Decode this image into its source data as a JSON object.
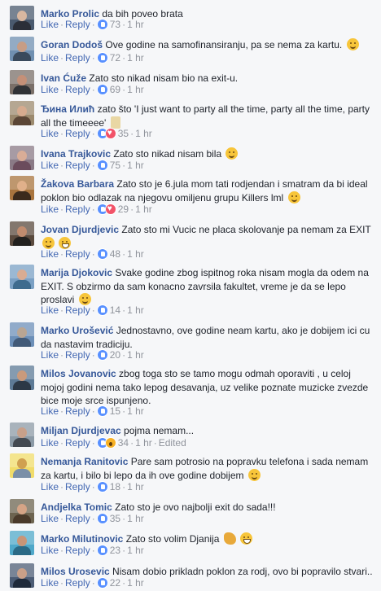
{
  "ui": {
    "like": "Like",
    "reply": "Reply",
    "hours": "1 hr",
    "edited": "Edited",
    "dot": "·"
  },
  "comments": [
    {
      "author": "Marko Prolic",
      "text": "da bih poveo brata",
      "reactions": [
        "like"
      ],
      "count": "73",
      "emoji": [],
      "edited": false,
      "avatar": [
        "#4a5a6e",
        "#d8b7a0",
        "#2b2f38"
      ]
    },
    {
      "author": "Goran Dodoš",
      "text": "Ove godine na samofinansiranju, pa se nema za kartu.",
      "reactions": [
        "like"
      ],
      "count": "72",
      "emoji": [
        "smile"
      ],
      "edited": false,
      "avatar": [
        "#6f8fb0",
        "#c79d85",
        "#3a4a5c"
      ]
    },
    {
      "author": "Ivan Ćuže",
      "text": "Zato sto nikad nisam bio na exit-u.",
      "reactions": [
        "like"
      ],
      "count": "69",
      "emoji": [],
      "edited": false,
      "avatar": [
        "#7a6f68",
        "#c49078",
        "#303236"
      ]
    },
    {
      "author": "Ђина Илић",
      "text": "zato što 'I just want to party all the time, party all the time, party all the timeeee'",
      "reactions": [
        "like",
        "love"
      ],
      "count": "35",
      "emoji": [
        "beer"
      ],
      "edited": false,
      "avatar": [
        "#9c8a6e",
        "#d6ab8f",
        "#5b4636"
      ]
    },
    {
      "author": "Ivana Trajkovic",
      "text": "Zato sto nikad nisam bila",
      "reactions": [
        "like"
      ],
      "count": "75",
      "emoji": [
        "smile"
      ],
      "edited": false,
      "avatar": [
        "#8a7a86",
        "#d9ad97",
        "#6b4c5c"
      ]
    },
    {
      "author": "Žakova Barbara",
      "text": "Zato sto je 6.jula mom tati rodjendan i smatram da bi ideal poklon bio odlazak na njegovu omiljenu grupu Killers lml",
      "reactions": [
        "like",
        "love"
      ],
      "count": "29",
      "emoji": [
        "smile"
      ],
      "edited": false,
      "avatar": [
        "#a8743e",
        "#e0b08a",
        "#3b2a1c"
      ]
    },
    {
      "author": "Jovan Djurdjevic",
      "text": "Zato sto mi Vucic ne placa skolovanje pa nemam za EXIT",
      "reactions": [
        "like"
      ],
      "count": "48",
      "emoji": [
        "smile",
        "laugh"
      ],
      "edited": false,
      "avatar": [
        "#5a4a3e",
        "#c08b6e",
        "#22201e"
      ]
    },
    {
      "author": "Marija Djokovic",
      "text": "Svake godine zbog ispitnog roka nisam mogla da odem na EXIT. S obzirmo da sam konacno zavrsila fakultet, vreme je da se lepo proslavi",
      "reactions": [
        "like"
      ],
      "count": "14",
      "emoji": [
        "smile"
      ],
      "edited": false,
      "avatar": [
        "#7aa0c4",
        "#d9ac93",
        "#3e6b8e"
      ]
    },
    {
      "author": "Marko Urošević",
      "text": "Jednostavno, ove godine neam kartu, ako je dobijem ici cu da nastavim tradiciju.",
      "reactions": [
        "like"
      ],
      "count": "20",
      "emoji": [],
      "edited": false,
      "avatar": [
        "#6c8fb8",
        "#b9a593",
        "#425a78"
      ]
    },
    {
      "author": "Milos Jovanovic",
      "text": "zbog toga sto se tamo mogu odmah oporaviti , u celoj mojoj godini nema tako lepog desavanja, uz velike poznate muzicke zvezde bice moje srce ispunjeno.",
      "reactions": [
        "like"
      ],
      "count": "15",
      "emoji": [],
      "edited": false,
      "avatar": [
        "#5d7a96",
        "#c99a7c",
        "#2c3846"
      ]
    },
    {
      "author": "Miljan Djurdjevac",
      "text": "pojma nemam...",
      "reactions": [
        "like",
        "wow"
      ],
      "count": "34",
      "emoji": [],
      "edited": true,
      "avatar": [
        "#8c9aa6",
        "#c8a08a",
        "#444a52"
      ]
    },
    {
      "author": "Nemanja Ranitovic",
      "text": "Pare sam potrosio na popravku telefona i sada nemam za kartu, i bilo bi lepo da ih ove godine dobijem",
      "reactions": [
        "like"
      ],
      "count": "18",
      "emoji": [
        "smile"
      ],
      "edited": false,
      "avatar": [
        "#f1dc6a",
        "#d0a050",
        "#7a8fa8"
      ]
    },
    {
      "author": "Andjelka Tomic",
      "text": "Zato sto je ovo najbolji exit do sada!!!",
      "reactions": [
        "like"
      ],
      "count": "35",
      "emoji": [],
      "edited": false,
      "avatar": [
        "#6d6450",
        "#d5a486",
        "#4a3a2a"
      ]
    },
    {
      "author": "Marko Milutinovic",
      "text": "Zato sto volim Djanija",
      "reactions": [
        "like"
      ],
      "count": "23",
      "emoji": [
        "muscle",
        "laugh"
      ],
      "edited": false,
      "avatar": [
        "#4fa8c9",
        "#c99577",
        "#2b6a86"
      ]
    },
    {
      "author": "Milos Urosevic",
      "text": "Nisam dobio prikladn poklon za rodj, ovo bi popravilo stvari..",
      "reactions": [
        "like"
      ],
      "count": "22",
      "emoji": [],
      "edited": false,
      "avatar": [
        "#4c5c74",
        "#caa088",
        "#1f2a3a"
      ]
    }
  ]
}
